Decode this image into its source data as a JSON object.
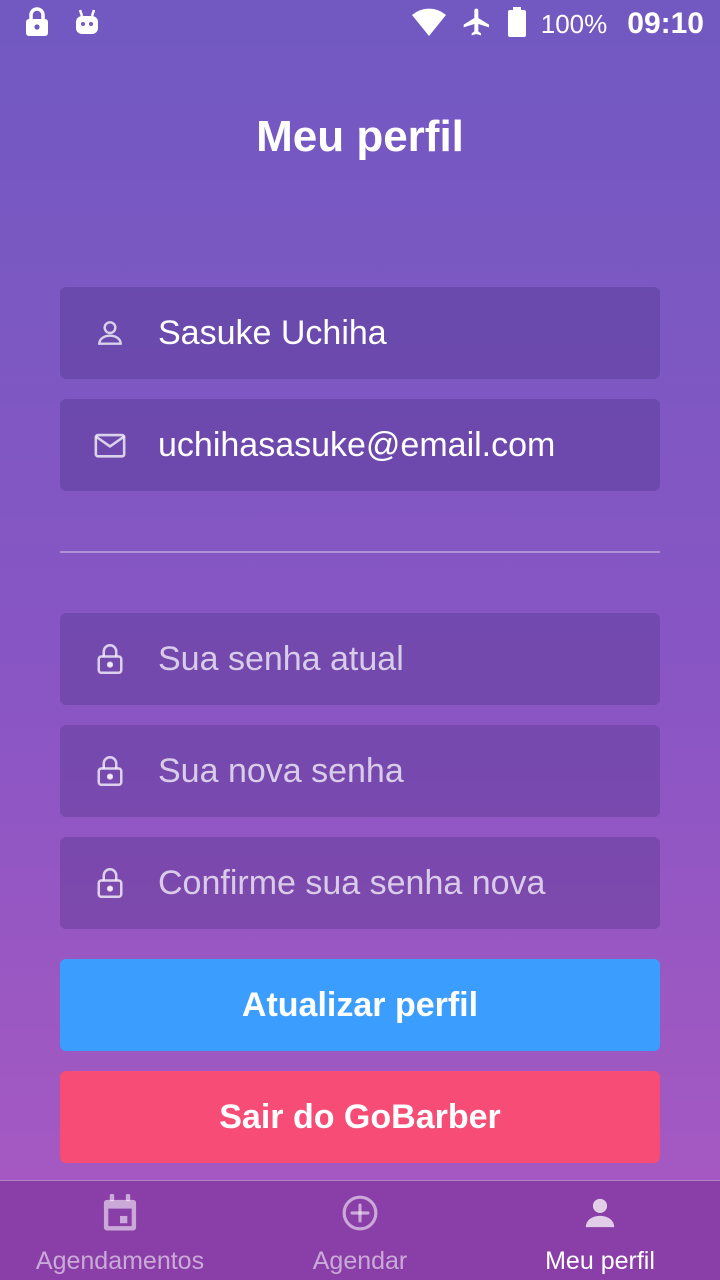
{
  "status_bar": {
    "battery": "100%",
    "time": "09:10",
    "icons": [
      "lock-icon",
      "android-icon",
      "wifi-icon",
      "airplane-icon",
      "battery-icon"
    ]
  },
  "header": {
    "title": "Meu perfil"
  },
  "form": {
    "name": {
      "value": "Sasuke Uchiha",
      "icon": "user-icon"
    },
    "email": {
      "value": "uchihasasuke@email.com",
      "icon": "mail-icon"
    },
    "old_password": {
      "placeholder": "Sua senha atual",
      "icon": "lock-icon"
    },
    "new_password": {
      "placeholder": "Sua nova senha",
      "icon": "lock-icon"
    },
    "confirm_password": {
      "placeholder": "Confirme sua senha nova",
      "icon": "lock-icon"
    }
  },
  "buttons": {
    "update": "Atualizar perfil",
    "logout": "Sair do GoBarber"
  },
  "tabbar": {
    "items": [
      {
        "label": "Agendamentos",
        "icon": "calendar-icon",
        "active": false
      },
      {
        "label": "Agendar",
        "icon": "add-circle-icon",
        "active": false
      },
      {
        "label": "Meu perfil",
        "icon": "person-icon",
        "active": true
      }
    ]
  },
  "colors": {
    "background_top": "#7159c1",
    "background_bottom": "#ab59c1",
    "update_button": "#3b9eff",
    "logout_button": "#f64c75",
    "tabbar": "#8a3fa8"
  }
}
